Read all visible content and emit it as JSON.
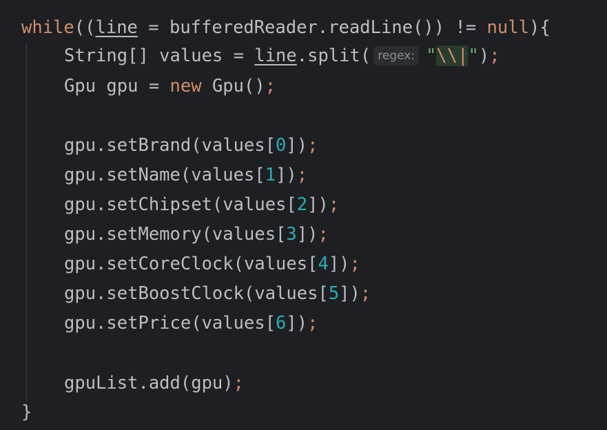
{
  "code": {
    "line1": {
      "kw_while": "while",
      "p1": "((",
      "var_line": "line",
      "p2": " = bufferedReader.readLine()) != ",
      "kw_null": "null",
      "p3": "){"
    },
    "line2": {
      "p1": "String[] values = ",
      "var_line": "line",
      "p2": ".split(",
      "hint": "regex:",
      "str_quote1": "\"",
      "str_escape": "\\\\|",
      "str_quote2": "\"",
      "p3": ")",
      "semi": ";"
    },
    "line3": {
      "p1": "Gpu gpu = ",
      "kw_new": "new",
      "p2": " Gpu()",
      "semi": ";"
    },
    "line4": {
      "p1": "gpu.setBrand(values[",
      "idx": "0",
      "p2": "])",
      "semi": ";"
    },
    "line5": {
      "p1": "gpu.setName(values[",
      "idx": "1",
      "p2": "])",
      "semi": ";"
    },
    "line6": {
      "p1": "gpu.setChipset(values[",
      "idx": "2",
      "p2": "])",
      "semi": ";"
    },
    "line7": {
      "p1": "gpu.setMemory(values[",
      "idx": "3",
      "p2": "])",
      "semi": ";"
    },
    "line8": {
      "p1": "gpu.setCoreClock(values[",
      "idx": "4",
      "p2": "])",
      "semi": ";"
    },
    "line9": {
      "p1": "gpu.setBoostClock(values[",
      "idx": "5",
      "p2": "])",
      "semi": ";"
    },
    "line10": {
      "p1": "gpu.setPrice(values[",
      "idx": "6",
      "p2": "])",
      "semi": ";"
    },
    "line11": {
      "p1": "gpuList.add(gpu)",
      "semi": ";"
    },
    "line12": {
      "p1": "}"
    }
  },
  "colors": {
    "background": "#1e1f22",
    "text": "#bcbec4",
    "keyword": "#cf8e6d",
    "number": "#2aacb8",
    "string": "#6aab73",
    "hint_background": "#2b2d30"
  }
}
